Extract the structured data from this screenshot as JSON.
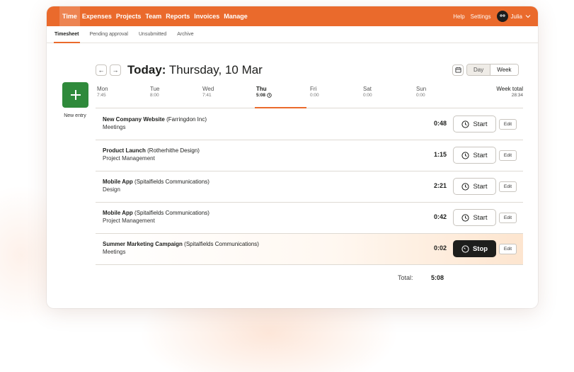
{
  "nav": {
    "items": [
      {
        "label": "Time",
        "active": true
      },
      {
        "label": "Expenses"
      },
      {
        "label": "Projects"
      },
      {
        "label": "Team"
      },
      {
        "label": "Reports"
      },
      {
        "label": "Invoices"
      },
      {
        "label": "Manage"
      }
    ],
    "help": "Help",
    "settings": "Settings",
    "user": "Julia"
  },
  "subnav": {
    "items": [
      {
        "label": "Timesheet",
        "active": true
      },
      {
        "label": "Pending approval"
      },
      {
        "label": "Unsubmitted"
      },
      {
        "label": "Archive"
      }
    ]
  },
  "header": {
    "today_label": "Today:",
    "date": "Thursday, 10 Mar",
    "prev_icon": "←",
    "next_icon": "→",
    "view_day": "Day",
    "view_week": "Week",
    "active_view": "Day"
  },
  "new_entry": {
    "label": "New entry",
    "icon": "+"
  },
  "days": [
    {
      "name": "Mon",
      "value": "7:45"
    },
    {
      "name": "Tue",
      "value": "8:00"
    },
    {
      "name": "Wed",
      "value": "7:41"
    },
    {
      "name": "Thu",
      "value": "5:08",
      "today": true
    },
    {
      "name": "Fri",
      "value": "0:00"
    },
    {
      "name": "Sat",
      "value": "0:00"
    },
    {
      "name": "Sun",
      "value": "0:00"
    }
  ],
  "week_total": {
    "label": "Week total",
    "value": "28:34"
  },
  "entries": [
    {
      "project": "New Company Website",
      "client": "(Farringdon Inc)",
      "task": "Meetings",
      "duration": "0:48",
      "action": "Start",
      "edit": "Edit"
    },
    {
      "project": "Product Launch",
      "client": "(Rotherhithe Design)",
      "task": "Project Management",
      "duration": "1:15",
      "action": "Start",
      "edit": "Edit"
    },
    {
      "project": "Mobile App",
      "client": "(Spitalfields Communications)",
      "task": "Design",
      "duration": "2:21",
      "action": "Start",
      "edit": "Edit"
    },
    {
      "project": "Mobile App",
      "client": "(Spitalfields Communications)",
      "task": "Project Management",
      "duration": "0:42",
      "action": "Start",
      "edit": "Edit"
    },
    {
      "project": "Summer Marketing Campaign",
      "client": "(Spitalfields Communications)",
      "task": "Meetings",
      "duration": "0:02",
      "action": "Stop",
      "edit": "Edit",
      "running": true
    }
  ],
  "total": {
    "label": "Total:",
    "value": "5:08"
  },
  "colors": {
    "brand": "#ea6a2c",
    "new_entry": "#2f8a3b",
    "stop": "#1d1e1c"
  }
}
